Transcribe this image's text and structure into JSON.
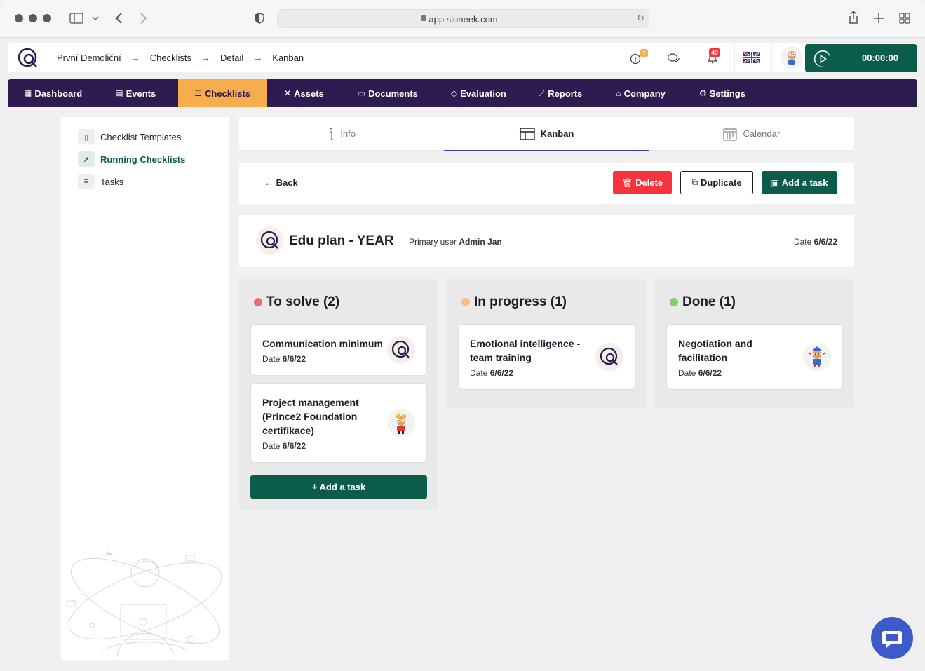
{
  "browser": {
    "url": "app.sloneek.com"
  },
  "topbar": {
    "breadcrumbs": [
      "První Demoliční",
      "Checklists",
      "Detail",
      "Kanban"
    ],
    "breadcrumb_separator": "→",
    "alert_badge": "1",
    "notification_badge": "40",
    "timer": "00:00:00"
  },
  "nav": {
    "items": [
      {
        "label": "Dashboard",
        "icon": "grid-icon"
      },
      {
        "label": "Events",
        "icon": "calendar-icon"
      },
      {
        "label": "Checklists",
        "icon": "checklist-icon",
        "active": true
      },
      {
        "label": "Assets",
        "icon": "tools-icon"
      },
      {
        "label": "Documents",
        "icon": "folder-icon"
      },
      {
        "label": "Evaluation",
        "icon": "evaluation-icon"
      },
      {
        "label": "Reports",
        "icon": "chart-icon"
      },
      {
        "label": "Company",
        "icon": "building-icon"
      },
      {
        "label": "Settings",
        "icon": "gear-icon"
      }
    ]
  },
  "sidebar": {
    "items": [
      {
        "label": "Checklist Templates",
        "icon": "clipboard-icon"
      },
      {
        "label": "Running Checklists",
        "icon": "rocket-icon",
        "active": true
      },
      {
        "label": "Tasks",
        "icon": "list-icon"
      }
    ]
  },
  "tabs": [
    {
      "label": "Info",
      "icon": "info-icon"
    },
    {
      "label": "Kanban",
      "icon": "kanban-icon",
      "active": true
    },
    {
      "label": "Calendar",
      "icon": "calendar-icon"
    }
  ],
  "actions": {
    "back": "Back",
    "delete": "Delete",
    "duplicate": "Duplicate",
    "add_task": "Add a task"
  },
  "plan": {
    "title": "Edu plan - YEAR",
    "primary_user_label": "Primary user",
    "primary_user": "Admin Jan",
    "date_label": "Date",
    "date": "6/6/22"
  },
  "columns": [
    {
      "title": "To solve (2)",
      "color": "#f46b6b",
      "cards": [
        {
          "title": "Communication minimum",
          "date_label": "Date",
          "date": "6/6/22",
          "avatar": "logo"
        },
        {
          "title": "Project management (Prince2 Foundation certifikace)",
          "date_label": "Date",
          "date": "6/6/22",
          "avatar": "king"
        }
      ],
      "add_label": "+ Add a task"
    },
    {
      "title": "In progress (1)",
      "color": "#f8be82",
      "cards": [
        {
          "title": "Emotional intelligence - team training",
          "date_label": "Date",
          "date": "6/6/22",
          "avatar": "logo"
        }
      ]
    },
    {
      "title": "Done (1)",
      "color": "#7fcf6a",
      "cards": [
        {
          "title": "Negotiation and facilitation",
          "date_label": "Date",
          "date": "6/6/22",
          "avatar": "character"
        }
      ]
    }
  ],
  "colors": {
    "nav_bg": "#2e1b4f",
    "accent_orange": "#f8ad4c",
    "primary_green": "#0c5c4c",
    "danger": "#f5343d",
    "tab_underline": "#3d3bb8"
  }
}
